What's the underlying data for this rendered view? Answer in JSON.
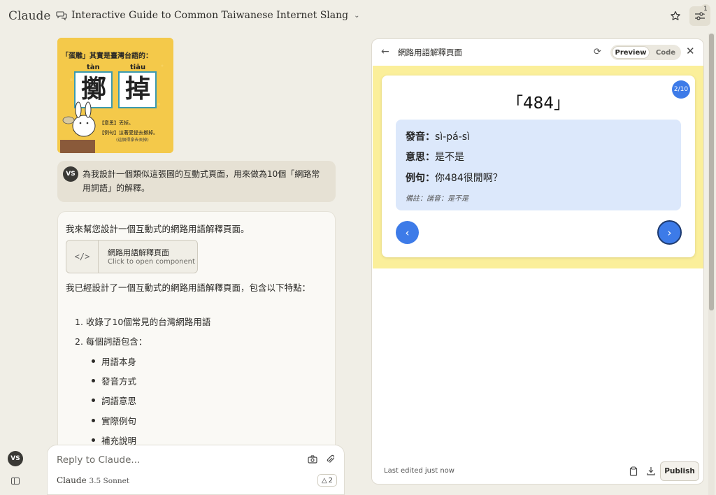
{
  "header": {
    "logo": "Claude",
    "title": "Interactive Guide to Common Taiwanese Internet Slang",
    "settings_badge": "1"
  },
  "chat": {
    "sticker": {
      "heading": "「蛋雕」其實是臺灣台語的：",
      "pinyin_left": "tàn",
      "pinyin_right": "tiāu",
      "char_left": "擲",
      "char_right": "掉",
      "meaning": "【意思】丟掉。",
      "example": "【例句】這著愛提去擲掉。",
      "example_sub": "(這個得拿去丟掉)"
    },
    "user_avatar": "VS",
    "user_message": "為我設計一個類似這張圖的互動式頁面，用來做為10個「網路常用詞語」的解釋。",
    "assistant": {
      "intro": "我來幫您設計一個互動式的網路用語解釋頁面。",
      "artifact_title": "網路用語解釋頁面",
      "artifact_subtitle": "Click to open component",
      "paragraph": "我已經設計了一個互動式的網路用語解釋頁面，包含以下特點：",
      "ordered": [
        "收錄了10個常見的台灣網路用語",
        "每個詞語包含："
      ],
      "bullets": [
        "用語本身",
        "發音方式",
        "詞語意思",
        "實際例句",
        "補充說明"
      ]
    },
    "reply_placeholder": "Reply to Claude...",
    "model_name": "Claude",
    "model_version": "3.5 Sonnet",
    "counter": "2",
    "bottom_avatar": "VS"
  },
  "artifact_panel": {
    "title": "網路用語解釋頁面",
    "tab_preview": "Preview",
    "tab_code": "Code",
    "page_indicator": "2/10",
    "term": "「484」",
    "pronunciation_label": "發音：",
    "pronunciation": "sì-pá-sì",
    "meaning_label": "意思：",
    "meaning": "是不是",
    "example_label": "例句：",
    "example": "你484很閒啊？",
    "note": "備註：諧音：是不是",
    "last_edited": "Last edited just now",
    "publish": "Publish"
  },
  "colors": {
    "accent_blue": "#3d7be8",
    "preview_bg": "#fbef9a",
    "info_box": "#dce8fb",
    "page_bg": "#f0eee6"
  }
}
